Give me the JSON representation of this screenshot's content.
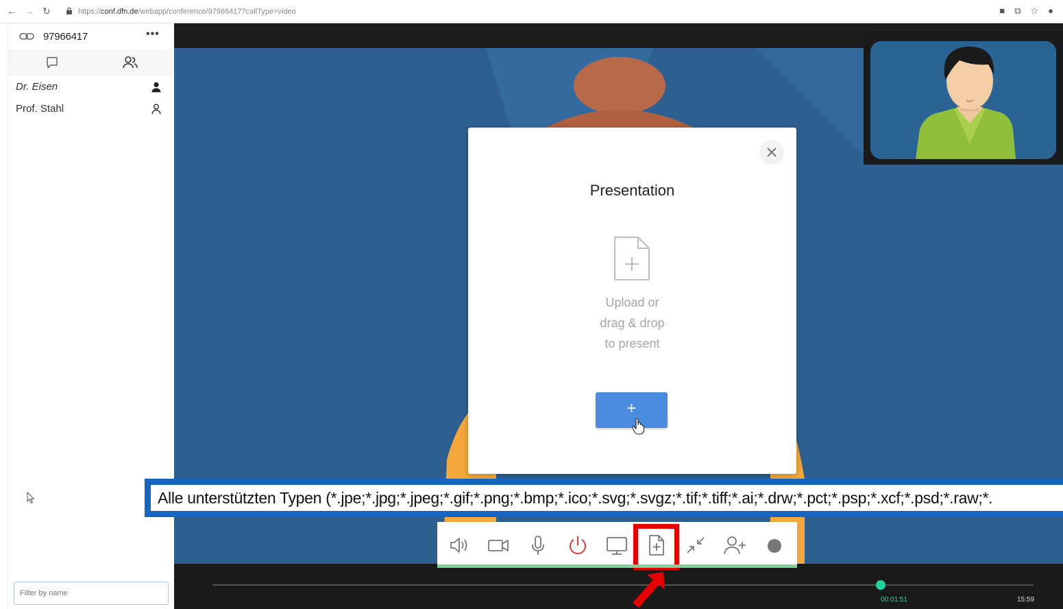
{
  "browser": {
    "url_prefix": "https://",
    "url_host": "conf.dfn.de",
    "url_path": "/webapp/conference/97966417?callType=video"
  },
  "sidebar": {
    "room_id": "97966417",
    "more_label": "•••",
    "participants": [
      {
        "name": "Dr. Eisen",
        "style": "italic",
        "icon": "person-filled-icon"
      },
      {
        "name": "Prof. Stahl",
        "style": "normal",
        "icon": "person-outline-icon"
      }
    ],
    "filter_placeholder": "Filter by name"
  },
  "modal": {
    "title": "Presentation",
    "hint_line1": "Upload or",
    "hint_line2": "drag & drop",
    "hint_line3": "to present",
    "add_label": "+"
  },
  "tooltip": {
    "text": "Alle unterstützten Typen (*.jpe;*.jpg;*.jpeg;*.gif;*.png;*.bmp;*.ico;*.svg;*.svgz;*.tif;*.tiff;*.ai;*.drw;*.pct;*.psp;*.xcf;*.psd;*.raw;*."
  },
  "toolbar": {
    "buttons": [
      "speaker-icon",
      "camera-icon",
      "microphone-icon",
      "power-icon",
      "screen-share-icon",
      "file-add-icon",
      "minimize-icon",
      "add-person-icon",
      "record-icon"
    ],
    "highlighted": "file-add-icon"
  },
  "player": {
    "time_current": "00:01:51",
    "time_total": "15:59",
    "progress": 0.814
  },
  "colors": {
    "accent": "#4a8de0",
    "hangup": "#e53935",
    "highlight": "#e60000",
    "progress_knob": "#1dd6a0",
    "tooltip_border": "#1565c0"
  }
}
